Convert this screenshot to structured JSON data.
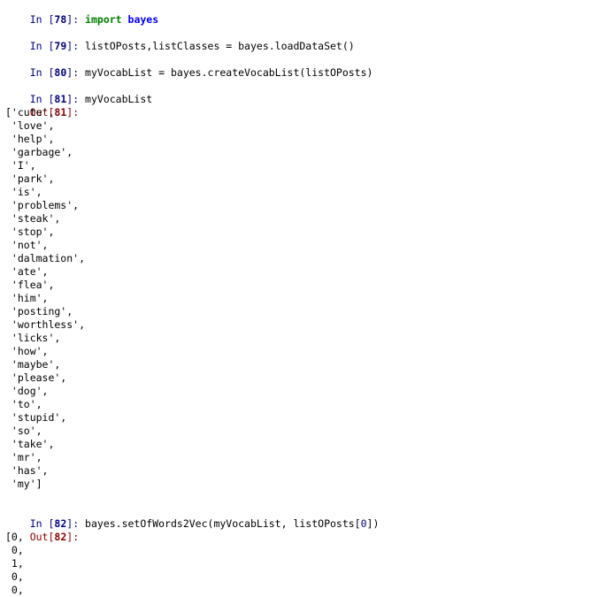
{
  "cells": [
    {
      "in_label": "In [",
      "in_num": "78",
      "in_suffix": "]: ",
      "code_kw": "import",
      "code_mod": "bayes"
    },
    {
      "in_label": "In [",
      "in_num": "79",
      "in_suffix": "]: ",
      "code": "listOPosts,listClasses = bayes.loadDataSet()"
    },
    {
      "in_label": "In [",
      "in_num": "80",
      "in_suffix": "]: ",
      "code": "myVocabList = bayes.createVocabList(listOPosts)"
    },
    {
      "in_label": "In [",
      "in_num": "81",
      "in_suffix": "]: ",
      "code": "myVocabList",
      "out_label": "Out[",
      "out_num": "81",
      "out_suffix": "]:",
      "output_lines": [
        "['cute',",
        " 'love',",
        " 'help',",
        " 'garbage',",
        " 'I',",
        " 'park',",
        " 'is',",
        " 'problems',",
        " 'steak',",
        " 'stop',",
        " 'not',",
        " 'dalmation',",
        " 'ate',",
        " 'flea',",
        " 'him',",
        " 'posting',",
        " 'worthless',",
        " 'licks',",
        " 'how',",
        " 'maybe',",
        " 'please',",
        " 'dog',",
        " 'to',",
        " 'stupid',",
        " 'so',",
        " 'take',",
        " 'mr',",
        " 'has',",
        " 'my']"
      ]
    },
    {
      "in_label": "In [",
      "in_num": "82",
      "in_suffix": "]: ",
      "code_pre": "bayes.setOfWords2Vec(myVocabList, listOPosts[",
      "code_num": "0",
      "code_post": "])",
      "out_label": "Out[",
      "out_num": "82",
      "out_suffix": "]:",
      "output_lines": [
        "[0,",
        " 0,",
        " 1,",
        " 0,",
        " 0,"
      ]
    }
  ]
}
